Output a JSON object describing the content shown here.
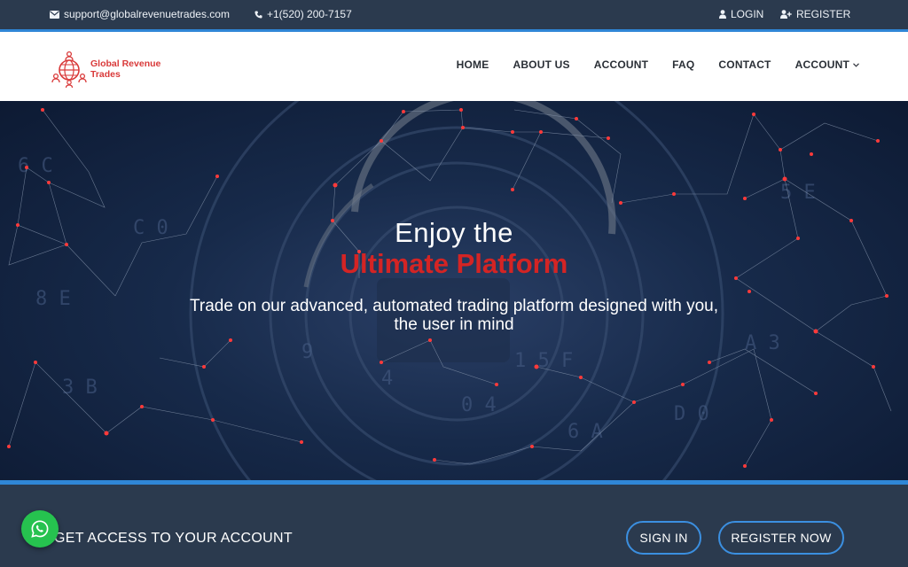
{
  "topbar": {
    "email": "support@globalrevenuetrades.com",
    "phone": "+1(520) 200-7157",
    "login_label": "LOGIN",
    "register_label": "REGISTER"
  },
  "header": {
    "logo_text": "Global Revenue Trades",
    "nav": [
      "HOME",
      "ABOUT US",
      "ACCOUNT",
      "FAQ",
      "CONTACT",
      "ACCOUNT"
    ]
  },
  "hero": {
    "title_line1": "Enjoy the",
    "title_line2": "Ultimate Platform",
    "subtitle": "Trade on our advanced, automated trading platform designed with you, the user in mind"
  },
  "access": {
    "label": "GET ACCESS TO YOUR ACCOUNT",
    "signin_label": "SIGN IN",
    "register_label": "REGISTER NOW"
  },
  "colors": {
    "topbar_bg": "#2b3a4e",
    "accent_blue": "#2f86d6",
    "brand_red": "#d42424",
    "whatsapp_green": "#26c24f"
  },
  "icons": {
    "email": "envelope-icon",
    "phone": "phone-icon",
    "login": "user-icon",
    "register": "user-plus-icon",
    "dropdown": "chevron-down-icon",
    "chat": "whatsapp-icon"
  }
}
